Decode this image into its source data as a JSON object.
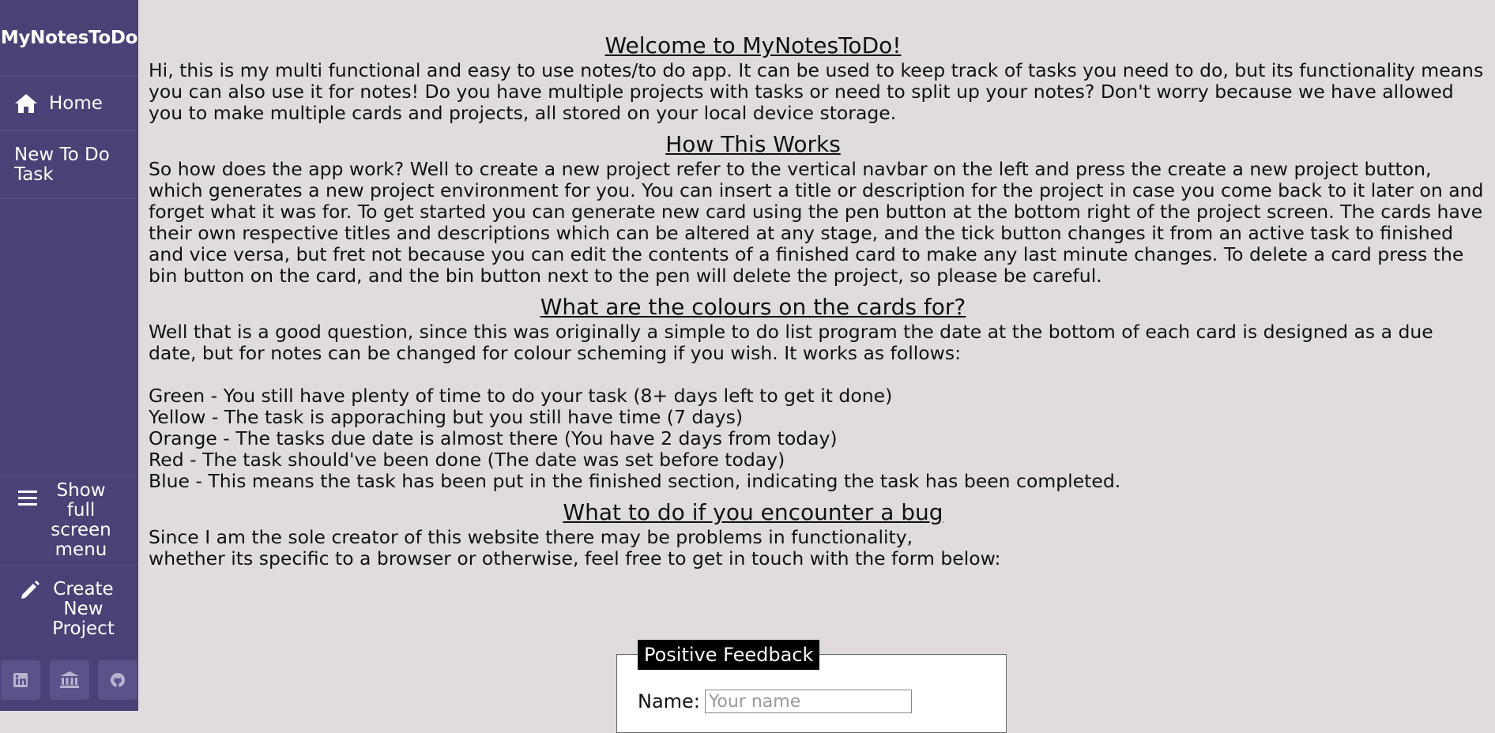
{
  "sidebar": {
    "brand": "MyNotesToDo",
    "home_label": "Home",
    "new_todo_label": "New To Do Task",
    "fullmenu_label": "Show full screen menu",
    "create_label": "Create New Project",
    "socials": [
      "linkedin-icon",
      "bank-icon",
      "github-icon"
    ]
  },
  "content": {
    "welcome_heading": "Welcome to MyNotesToDo!",
    "welcome_text": "Hi, this is my multi functional and easy to use notes/to do app. It can be used to keep track of tasks you need to do, but its functionality means you can also use it for notes! Do you have multiple projects with tasks or need to split up your notes? Don't worry because we have allowed you to make multiple cards and projects, all stored on your local device storage.",
    "how_heading": "How This Works",
    "how_text": "So how does the app work? Well to create a new project refer to the vertical navbar on the left and press the create a new project button, which generates a new project environment for you. You can insert a title or description for the project in case you come back to it later on and forget what it was for. To get started you can generate new card using the pen button at the bottom right of the project screen. The cards have their own respective titles and descriptions which can be altered at any stage, and the tick button changes it from an active task to finished and vice versa, but fret not because you can edit the contents of a finished card to make any last minute changes. To delete a card press the bin button on the card, and the bin button next to the pen will delete the project, so please be careful.",
    "colours_heading": "What are the colours on the cards for?",
    "colours_intro": "Well that is a good question, since this was originally a simple to do list program the date at the bottom of each card is designed as a due date, but for notes can be changed for colour scheming if you wish. It works as follows:",
    "colours_list": [
      "Green - You still have plenty of time to do your task (8+ days left to get it done)",
      "Yellow - The task is apporaching but you still have time (7 days)",
      "Orange - The tasks due date is almost there (You have 2 days from today)",
      "Red - The task should've been done (The date was set before today)",
      "Blue - This means the task has been put in the finished section, indicating the task has been completed."
    ],
    "bug_heading": "What to do if you encounter a bug",
    "bug_text_1": "Since I am the sole creator of this website there may be problems in functionality,",
    "bug_text_2": "whether its specific to a browser or otherwise, feel free to get in touch with the form below:"
  },
  "feedback_form": {
    "legend": "Positive Feedback",
    "name_label": "Name:",
    "name_placeholder": "Your name",
    "name_value": ""
  },
  "colors": {
    "sidebar_bg": "#4a4177",
    "page_bg": "#e0dcdd"
  }
}
